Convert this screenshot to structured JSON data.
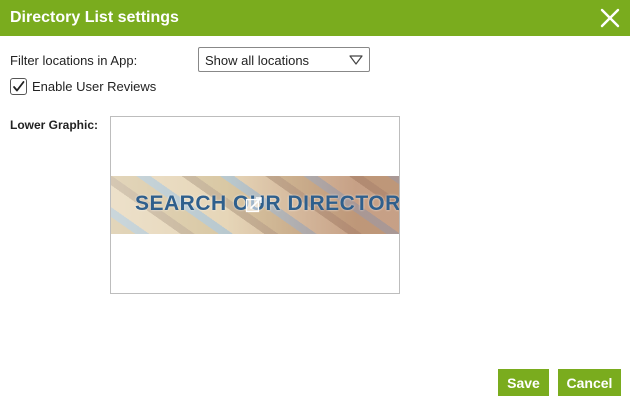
{
  "dialog": {
    "title": "Directory List settings",
    "accent_color": "#7aac1e"
  },
  "filter": {
    "label": "Filter locations in App:",
    "selected": "Show all locations"
  },
  "reviews": {
    "label": "Enable User Reviews",
    "checked": true
  },
  "lower_graphic": {
    "label": "Lower Graphic:",
    "banner_text": "SEARCH OUR DIRECTORY"
  },
  "buttons": {
    "save": "Save",
    "cancel": "Cancel"
  },
  "icons": {
    "close": "close-icon",
    "dropdown": "chevron-down-icon",
    "check": "checkmark-icon",
    "edit": "edit-icon"
  }
}
